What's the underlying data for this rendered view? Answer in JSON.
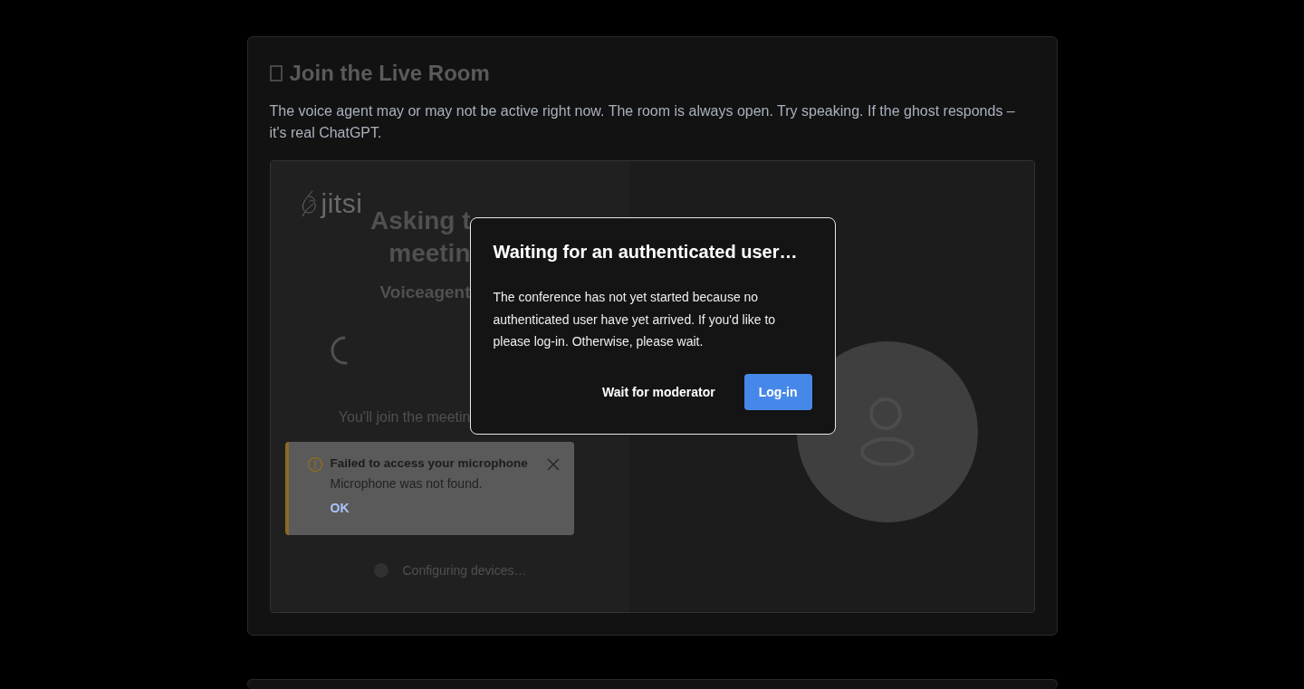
{
  "section": {
    "title": "Join the Live Room",
    "description": "The voice agent may or may not be active right now. The room is always open. Try speaking. If the ghost responds – it's real ChatGPT."
  },
  "meeting": {
    "logo_text": "jitsi",
    "heading_line_1": "Asking t",
    "heading_line_2": "meetin",
    "room_name": "Voiceagent",
    "join_note": "You'll join the meetin",
    "status": "Configuring devices…"
  },
  "toast": {
    "title": "Failed to access your microphone",
    "message": "Microphone was not found.",
    "action": "OK"
  },
  "dialog": {
    "title": "Waiting for an authenticated user…",
    "message": "The conference has not yet started because no authenticated user have yet arrived. If you'd like to please log-in. Otherwise, please wait.",
    "buttons": [
      {
        "label": "Wait for moderator",
        "kind": "text"
      },
      {
        "label": "Log-in",
        "kind": "primary"
      }
    ]
  }
}
